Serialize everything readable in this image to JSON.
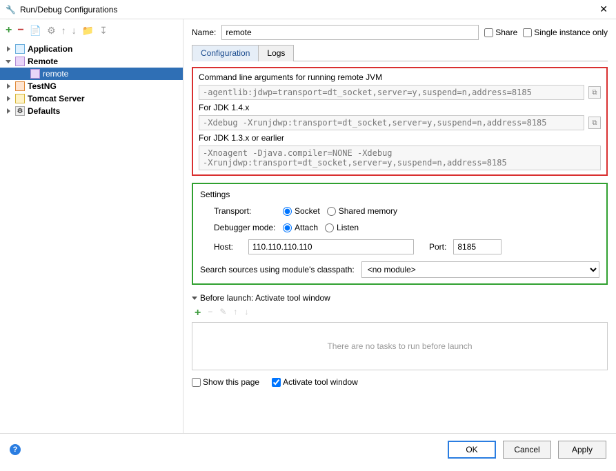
{
  "window": {
    "title": "Run/Debug Configurations"
  },
  "toolbar": {
    "add": "+",
    "remove": "−"
  },
  "tree": {
    "application": "Application",
    "remote_group": "Remote",
    "remote_child": "remote",
    "testng": "TestNG",
    "tomcat": "Tomcat Server",
    "defaults": "Defaults"
  },
  "name": {
    "label": "Name:",
    "value": "remote"
  },
  "share": {
    "label": "Share"
  },
  "single": {
    "label": "Single instance only"
  },
  "tabs": {
    "config": "Configuration",
    "logs": "Logs"
  },
  "cmd": {
    "label1": "Command line arguments for running remote JVM",
    "value1": "-agentlib:jdwp=transport=dt_socket,server=y,suspend=n,address=8185",
    "label2": "For JDK 1.4.x",
    "value2": "-Xdebug -Xrunjdwp:transport=dt_socket,server=y,suspend=n,address=8185",
    "label3": "For JDK 1.3.x or earlier",
    "value3": "-Xnoagent -Djava.compiler=NONE -Xdebug\n-Xrunjdwp:transport=dt_socket,server=y,suspend=n,address=8185"
  },
  "settings": {
    "title": "Settings",
    "transport_label": "Transport:",
    "socket": "Socket",
    "shared": "Shared memory",
    "mode_label": "Debugger mode:",
    "attach": "Attach",
    "listen": "Listen",
    "host_label": "Host:",
    "host_value": "110.110.110.110",
    "port_label": "Port:",
    "port_value": "8185",
    "classpath_label": "Search sources using module's classpath:",
    "classpath_value": "<no module>"
  },
  "before": {
    "header": "Before launch: Activate tool window",
    "empty": "There are no tasks to run before launch",
    "show": "Show this page",
    "activate": "Activate tool window"
  },
  "footer": {
    "ok": "OK",
    "cancel": "Cancel",
    "apply": "Apply"
  }
}
